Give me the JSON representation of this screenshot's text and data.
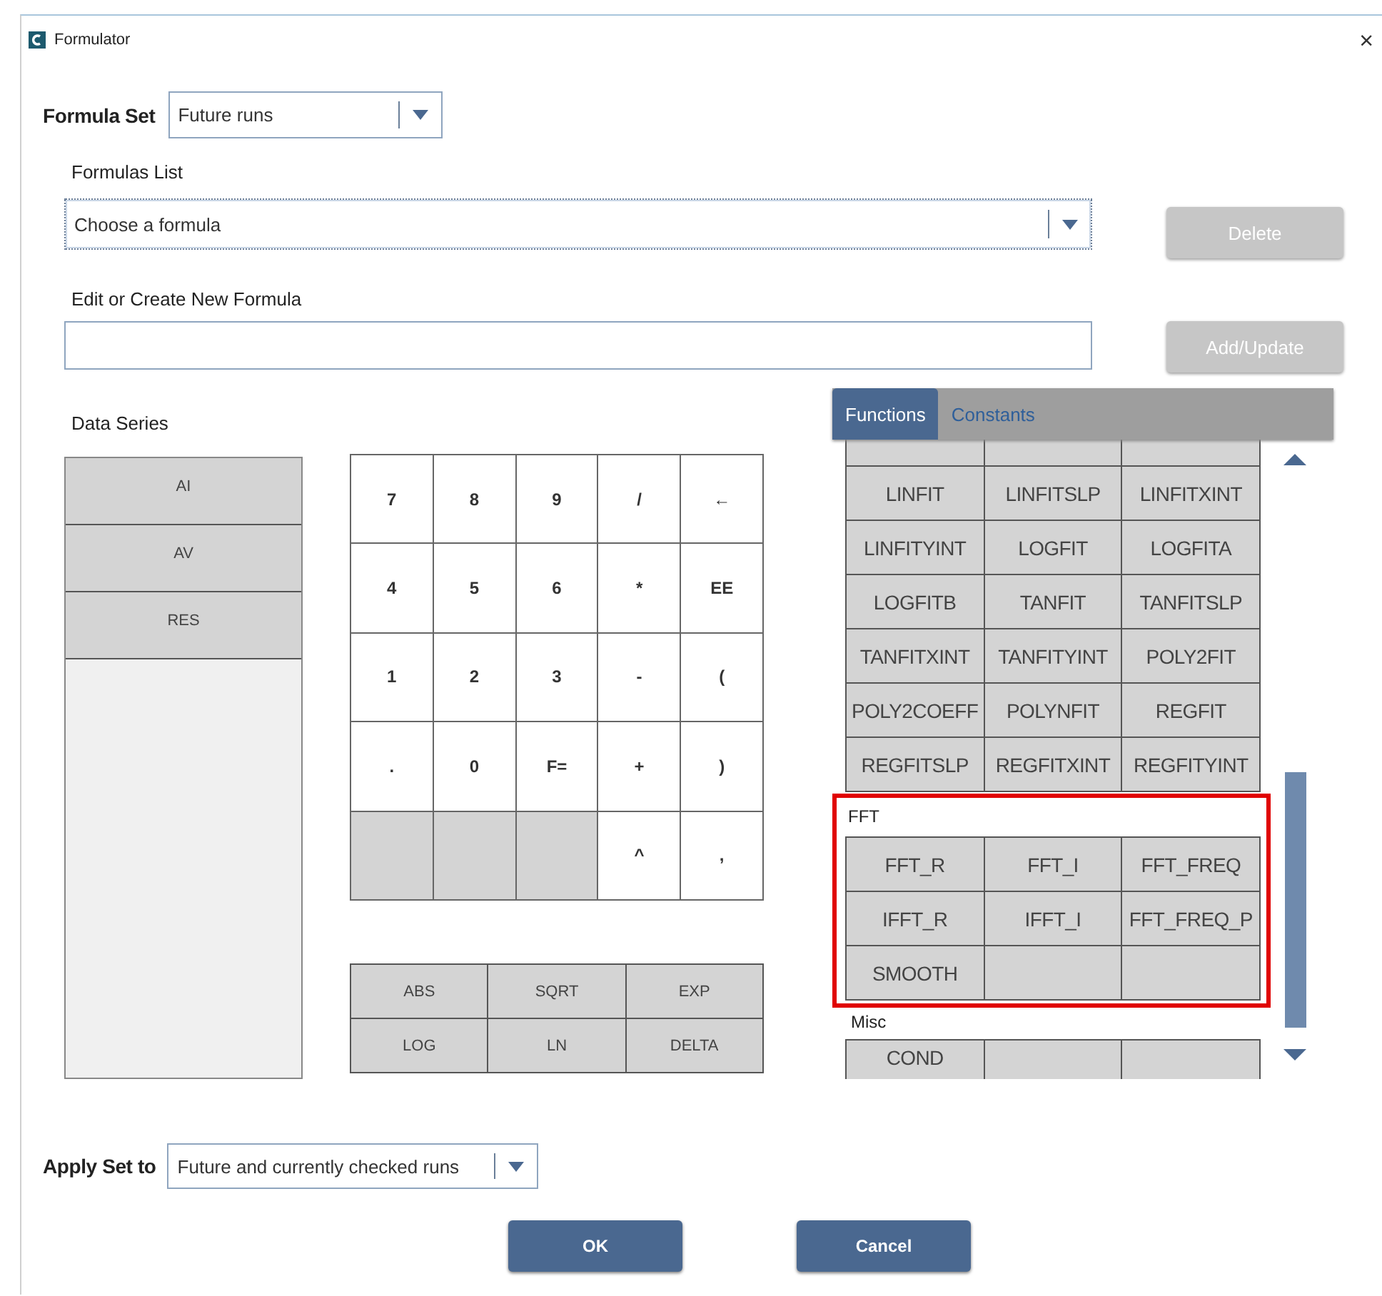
{
  "window": {
    "title": "Formulator",
    "close": "×"
  },
  "formula_set": {
    "label": "Formula Set",
    "value": "Future runs"
  },
  "formulas_list": {
    "label": "Formulas List",
    "value": "Choose a formula",
    "focused": true
  },
  "delete_button": {
    "label": "Delete",
    "disabled": true
  },
  "edit_formula": {
    "label": "Edit or Create New Formula"
  },
  "add_update_button": {
    "label": "Add/Update",
    "disabled": true
  },
  "data_series": {
    "label": "Data Series",
    "items": [
      "AI",
      "AV",
      "RES"
    ]
  },
  "keypad": [
    {
      "kind": "key",
      "label": "7"
    },
    {
      "kind": "key",
      "label": "8"
    },
    {
      "kind": "key",
      "label": "9"
    },
    {
      "kind": "key",
      "label": "/"
    },
    {
      "kind": "key",
      "label": "←"
    },
    {
      "kind": "key",
      "label": "4"
    },
    {
      "kind": "key",
      "label": "5"
    },
    {
      "kind": "key",
      "label": "6"
    },
    {
      "kind": "key",
      "label": "*"
    },
    {
      "kind": "key",
      "label": "EE"
    },
    {
      "kind": "key",
      "label": "1"
    },
    {
      "kind": "key",
      "label": "2"
    },
    {
      "kind": "key",
      "label": "3"
    },
    {
      "kind": "key",
      "label": "-"
    },
    {
      "kind": "key",
      "label": "("
    },
    {
      "kind": "key",
      "label": "."
    },
    {
      "kind": "key",
      "label": "0"
    },
    {
      "kind": "key",
      "label": "F="
    },
    {
      "kind": "key",
      "label": "+"
    },
    {
      "kind": "key",
      "label": ")"
    },
    {
      "kind": "blank"
    },
    {
      "kind": "blank"
    },
    {
      "kind": "blank"
    },
    {
      "kind": "key",
      "label": "^"
    },
    {
      "kind": "key",
      "label": ","
    }
  ],
  "math_functions": [
    "ABS",
    "SQRT",
    "EXP",
    "LOG",
    "LN",
    "DELTA"
  ],
  "function_tabs": [
    {
      "label": "Functions",
      "selected": true
    },
    {
      "label": "Constants",
      "selected": false
    }
  ],
  "function_groups": [
    {
      "highlighted": false,
      "cells": [
        {
          "kind": "covered"
        },
        {
          "kind": "covered"
        },
        {
          "kind": "covered"
        },
        {
          "kind": "function",
          "label": "LINFIT"
        },
        {
          "kind": "function",
          "label": "LINFITSLP"
        },
        {
          "kind": "function",
          "label": "LINFITXINT"
        },
        {
          "kind": "function",
          "label": "LINFITYINT"
        },
        {
          "kind": "function",
          "label": "LOGFIT"
        },
        {
          "kind": "function",
          "label": "LOGFITA"
        },
        {
          "kind": "function",
          "label": "LOGFITB"
        },
        {
          "kind": "function",
          "label": "TANFIT"
        },
        {
          "kind": "function",
          "label": "TANFITSLP"
        },
        {
          "kind": "function",
          "label": "TANFITXINT"
        },
        {
          "kind": "function",
          "label": "TANFITYINT"
        },
        {
          "kind": "function",
          "label": "POLY2FIT"
        },
        {
          "kind": "function",
          "label": "POLY2COEFF"
        },
        {
          "kind": "function",
          "label": "POLYNFIT"
        },
        {
          "kind": "function",
          "label": "REGFIT"
        },
        {
          "kind": "function",
          "label": "REGFITSLP"
        },
        {
          "kind": "function",
          "label": "REGFITXINT"
        },
        {
          "kind": "function",
          "label": "REGFITYINT"
        }
      ]
    },
    {
      "title": "FFT",
      "highlighted": true,
      "cells": [
        {
          "kind": "function",
          "label": "FFT_R"
        },
        {
          "kind": "function",
          "label": "FFT_I"
        },
        {
          "kind": "function",
          "label": "FFT_FREQ"
        },
        {
          "kind": "function",
          "label": "IFFT_R"
        },
        {
          "kind": "function",
          "label": "IFFT_I"
        },
        {
          "kind": "function",
          "label": "FFT_FREQ_P"
        },
        {
          "kind": "function",
          "label": "SMOOTH"
        },
        {
          "kind": "blank"
        },
        {
          "kind": "blank"
        }
      ]
    },
    {
      "title": "Misc",
      "highlighted": false,
      "cells": [
        {
          "kind": "function",
          "label": "COND"
        },
        {
          "kind": "blank"
        },
        {
          "kind": "blank"
        }
      ]
    }
  ],
  "apply_set": {
    "label": "Apply Set to",
    "value": "Future and currently checked runs"
  },
  "buttons": [
    {
      "label": "OK"
    },
    {
      "label": "Cancel"
    }
  ]
}
